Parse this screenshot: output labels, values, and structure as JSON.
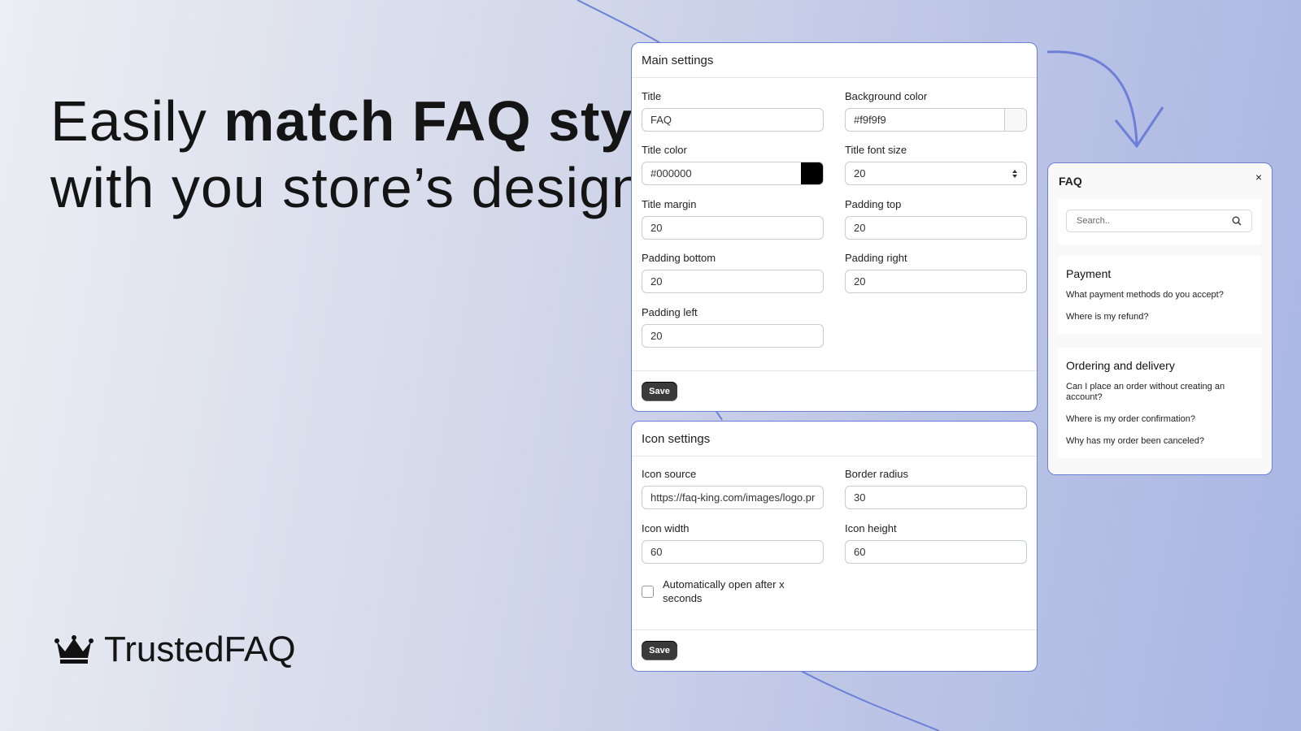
{
  "hero": {
    "line1_regular": "Easily ",
    "line1_bold": "match FAQ style",
    "line2": "with you store’s design"
  },
  "brand": {
    "icon": "crown-icon",
    "name": "TrustedFAQ"
  },
  "main_settings": {
    "title": "Main settings",
    "fields": {
      "title": {
        "label": "Title",
        "value": "FAQ"
      },
      "background_color": {
        "label": "Background color",
        "value": "#f9f9f9"
      },
      "title_color": {
        "label": "Title color",
        "value": "#000000"
      },
      "title_font_size": {
        "label": "Title font size",
        "value": "20"
      },
      "title_margin": {
        "label": "Title margin",
        "value": "20"
      },
      "padding_top": {
        "label": "Padding top",
        "value": "20"
      },
      "padding_bottom": {
        "label": "Padding bottom",
        "value": "20"
      },
      "padding_right": {
        "label": "Padding right",
        "value": "20"
      },
      "padding_left": {
        "label": "Padding left",
        "value": "20"
      }
    },
    "save_label": "Save"
  },
  "icon_settings": {
    "title": "Icon settings",
    "fields": {
      "icon_source": {
        "label": "Icon source",
        "value": "https://faq-king.com/images/logo.pr"
      },
      "border_radius": {
        "label": "Border radius",
        "value": "30"
      },
      "icon_width": {
        "label": "Icon width",
        "value": "60"
      },
      "icon_height": {
        "label": "Icon height",
        "value": "60"
      }
    },
    "auto_open_label": "Automatically open after x seconds",
    "auto_open_checked": false,
    "save_label": "Save"
  },
  "faq_preview": {
    "title": "FAQ",
    "close": "×",
    "search_placeholder": "Search..",
    "sections": [
      {
        "heading": "Payment",
        "questions": [
          "What payment methods do you accept?",
          "Where is my refund?"
        ]
      },
      {
        "heading": "Ordering and delivery",
        "questions": [
          "Can I place an order without creating an account?",
          "Where is my order confirmation?",
          "Why has my order been canceled?"
        ]
      }
    ]
  },
  "colors": {
    "accent": "#6d7fd6",
    "button": "#3a3a3a"
  }
}
